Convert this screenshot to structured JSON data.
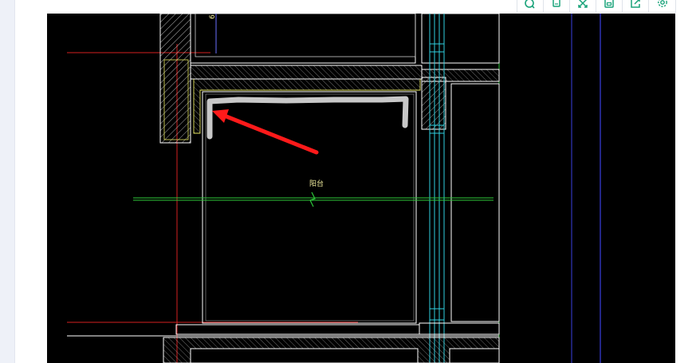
{
  "toolbar": {
    "items": [
      {
        "name": "zoom",
        "icon": "zoom-icon"
      },
      {
        "name": "copy",
        "icon": "copy-icon"
      },
      {
        "name": "fullscreen",
        "icon": "fullscreen-icon"
      },
      {
        "name": "save",
        "icon": "save-icon"
      },
      {
        "name": "share",
        "icon": "share-icon"
      },
      {
        "name": "settings",
        "icon": "settings-icon"
      }
    ],
    "icon_color": "#1aa37a"
  },
  "drawing": {
    "room_label": "阳台",
    "dimension_text": "6",
    "colors": {
      "background": "#000000",
      "wall_outline": "#ffffff",
      "hatch": "#d8d8d8",
      "inner_line": "#e8e860",
      "axis_red": "#d42020",
      "grid_green": "#2ec83a",
      "window_cyan": "#30d0e0",
      "guide_blue": "#3a40e0",
      "annotation_mark": "#c8c8c8",
      "arrow": "#ff1a1a"
    }
  }
}
